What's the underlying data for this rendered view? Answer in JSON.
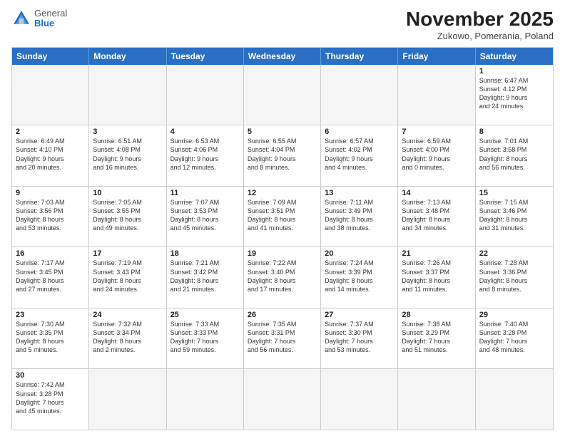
{
  "header": {
    "logo_general": "General",
    "logo_blue": "Blue",
    "month_title": "November 2025",
    "subtitle": "Zukowo, Pomerania, Poland"
  },
  "days_of_week": [
    "Sunday",
    "Monday",
    "Tuesday",
    "Wednesday",
    "Thursday",
    "Friday",
    "Saturday"
  ],
  "weeks": [
    [
      {
        "day": "",
        "empty": true
      },
      {
        "day": "",
        "empty": true
      },
      {
        "day": "",
        "empty": true
      },
      {
        "day": "",
        "empty": true
      },
      {
        "day": "",
        "empty": true
      },
      {
        "day": "",
        "empty": true
      },
      {
        "day": "1",
        "info": "Sunrise: 6:47 AM\nSunset: 4:12 PM\nDaylight: 9 hours\nand 24 minutes."
      }
    ],
    [
      {
        "day": "2",
        "info": "Sunrise: 6:49 AM\nSunset: 4:10 PM\nDaylight: 9 hours\nand 20 minutes."
      },
      {
        "day": "3",
        "info": "Sunrise: 6:51 AM\nSunset: 4:08 PM\nDaylight: 9 hours\nand 16 minutes."
      },
      {
        "day": "4",
        "info": "Sunrise: 6:53 AM\nSunset: 4:06 PM\nDaylight: 9 hours\nand 12 minutes."
      },
      {
        "day": "5",
        "info": "Sunrise: 6:55 AM\nSunset: 4:04 PM\nDaylight: 9 hours\nand 8 minutes."
      },
      {
        "day": "6",
        "info": "Sunrise: 6:57 AM\nSunset: 4:02 PM\nDaylight: 9 hours\nand 4 minutes."
      },
      {
        "day": "7",
        "info": "Sunrise: 6:59 AM\nSunset: 4:00 PM\nDaylight: 9 hours\nand 0 minutes."
      },
      {
        "day": "8",
        "info": "Sunrise: 7:01 AM\nSunset: 3:58 PM\nDaylight: 8 hours\nand 56 minutes."
      }
    ],
    [
      {
        "day": "9",
        "info": "Sunrise: 7:03 AM\nSunset: 3:56 PM\nDaylight: 8 hours\nand 53 minutes."
      },
      {
        "day": "10",
        "info": "Sunrise: 7:05 AM\nSunset: 3:55 PM\nDaylight: 8 hours\nand 49 minutes."
      },
      {
        "day": "11",
        "info": "Sunrise: 7:07 AM\nSunset: 3:53 PM\nDaylight: 8 hours\nand 45 minutes."
      },
      {
        "day": "12",
        "info": "Sunrise: 7:09 AM\nSunset: 3:51 PM\nDaylight: 8 hours\nand 41 minutes."
      },
      {
        "day": "13",
        "info": "Sunrise: 7:11 AM\nSunset: 3:49 PM\nDaylight: 8 hours\nand 38 minutes."
      },
      {
        "day": "14",
        "info": "Sunrise: 7:13 AM\nSunset: 3:48 PM\nDaylight: 8 hours\nand 34 minutes."
      },
      {
        "day": "15",
        "info": "Sunrise: 7:15 AM\nSunset: 3:46 PM\nDaylight: 8 hours\nand 31 minutes."
      }
    ],
    [
      {
        "day": "16",
        "info": "Sunrise: 7:17 AM\nSunset: 3:45 PM\nDaylight: 8 hours\nand 27 minutes."
      },
      {
        "day": "17",
        "info": "Sunrise: 7:19 AM\nSunset: 3:43 PM\nDaylight: 8 hours\nand 24 minutes."
      },
      {
        "day": "18",
        "info": "Sunrise: 7:21 AM\nSunset: 3:42 PM\nDaylight: 8 hours\nand 21 minutes."
      },
      {
        "day": "19",
        "info": "Sunrise: 7:22 AM\nSunset: 3:40 PM\nDaylight: 8 hours\nand 17 minutes."
      },
      {
        "day": "20",
        "info": "Sunrise: 7:24 AM\nSunset: 3:39 PM\nDaylight: 8 hours\nand 14 minutes."
      },
      {
        "day": "21",
        "info": "Sunrise: 7:26 AM\nSunset: 3:37 PM\nDaylight: 8 hours\nand 11 minutes."
      },
      {
        "day": "22",
        "info": "Sunrise: 7:28 AM\nSunset: 3:36 PM\nDaylight: 8 hours\nand 8 minutes."
      }
    ],
    [
      {
        "day": "23",
        "info": "Sunrise: 7:30 AM\nSunset: 3:35 PM\nDaylight: 8 hours\nand 5 minutes."
      },
      {
        "day": "24",
        "info": "Sunrise: 7:32 AM\nSunset: 3:34 PM\nDaylight: 8 hours\nand 2 minutes."
      },
      {
        "day": "25",
        "info": "Sunrise: 7:33 AM\nSunset: 3:33 PM\nDaylight: 7 hours\nand 59 minutes."
      },
      {
        "day": "26",
        "info": "Sunrise: 7:35 AM\nSunset: 3:31 PM\nDaylight: 7 hours\nand 56 minutes."
      },
      {
        "day": "27",
        "info": "Sunrise: 7:37 AM\nSunset: 3:30 PM\nDaylight: 7 hours\nand 53 minutes."
      },
      {
        "day": "28",
        "info": "Sunrise: 7:38 AM\nSunset: 3:29 PM\nDaylight: 7 hours\nand 51 minutes."
      },
      {
        "day": "29",
        "info": "Sunrise: 7:40 AM\nSunset: 3:28 PM\nDaylight: 7 hours\nand 48 minutes."
      }
    ],
    [
      {
        "day": "30",
        "info": "Sunrise: 7:42 AM\nSunset: 3:28 PM\nDaylight: 7 hours\nand 45 minutes."
      },
      {
        "day": "",
        "empty": true
      },
      {
        "day": "",
        "empty": true
      },
      {
        "day": "",
        "empty": true
      },
      {
        "day": "",
        "empty": true
      },
      {
        "day": "",
        "empty": true
      },
      {
        "day": "",
        "empty": true
      }
    ]
  ]
}
